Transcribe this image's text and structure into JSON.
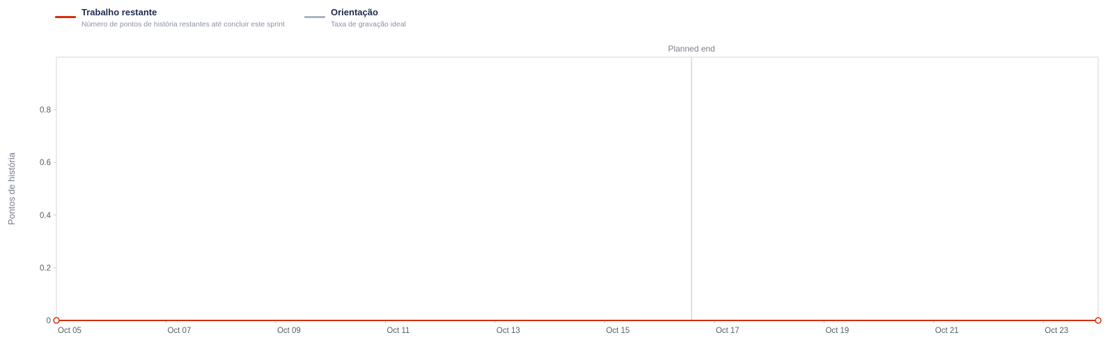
{
  "legend": {
    "items": [
      {
        "key": "remaining",
        "title": "Trabalho restante",
        "description": "Número de pontos de história restantes até concluir este sprint",
        "color": "#d62d0e"
      },
      {
        "key": "guideline",
        "title": "Orientação",
        "description": "Taxa de gravação ideal",
        "color": "#a9b2bf"
      }
    ]
  },
  "chart_data": {
    "type": "line",
    "ylabel": "Pontos de história",
    "ylim": [
      0,
      1
    ],
    "y_ticks": [
      {
        "value": 0,
        "label": "0"
      },
      {
        "value": 0.2,
        "label": "0.2"
      },
      {
        "value": 0.4,
        "label": "0.4"
      },
      {
        "value": 0.6,
        "label": "0.6"
      },
      {
        "value": 0.8,
        "label": "0.8"
      }
    ],
    "x_range": [
      "2025-10-05",
      "2025-10-24"
    ],
    "x_ticks": [
      {
        "value": "2025-10-05",
        "label": "Oct 05"
      },
      {
        "value": "2025-10-07",
        "label": "Oct 07"
      },
      {
        "value": "2025-10-09",
        "label": "Oct 09"
      },
      {
        "value": "2025-10-11",
        "label": "Oct 11"
      },
      {
        "value": "2025-10-13",
        "label": "Oct 13"
      },
      {
        "value": "2025-10-15",
        "label": "Oct 15"
      },
      {
        "value": "2025-10-17",
        "label": "Oct 17"
      },
      {
        "value": "2025-10-19",
        "label": "Oct 19"
      },
      {
        "value": "2025-10-21",
        "label": "Oct 21"
      },
      {
        "value": "2025-10-23",
        "label": "Oct 23"
      }
    ],
    "series": [
      {
        "name": "Trabalho restante",
        "color": "#d62d0e",
        "points": [
          {
            "x": "2025-10-05",
            "y": 0
          },
          {
            "x": "2025-10-24",
            "y": 0
          }
        ]
      },
      {
        "name": "Orientação",
        "color": "#a9b2bf",
        "points": [
          {
            "x": "2025-10-05",
            "y": 0
          },
          {
            "x": "2025-10-16T14:00",
            "y": 0
          }
        ]
      }
    ],
    "annotations": [
      {
        "type": "vertical-line",
        "x": "2025-10-16T14:00",
        "label": "Planned end",
        "color": "#c9ccd1"
      }
    ],
    "grid": false,
    "legend_position": "top-left"
  }
}
